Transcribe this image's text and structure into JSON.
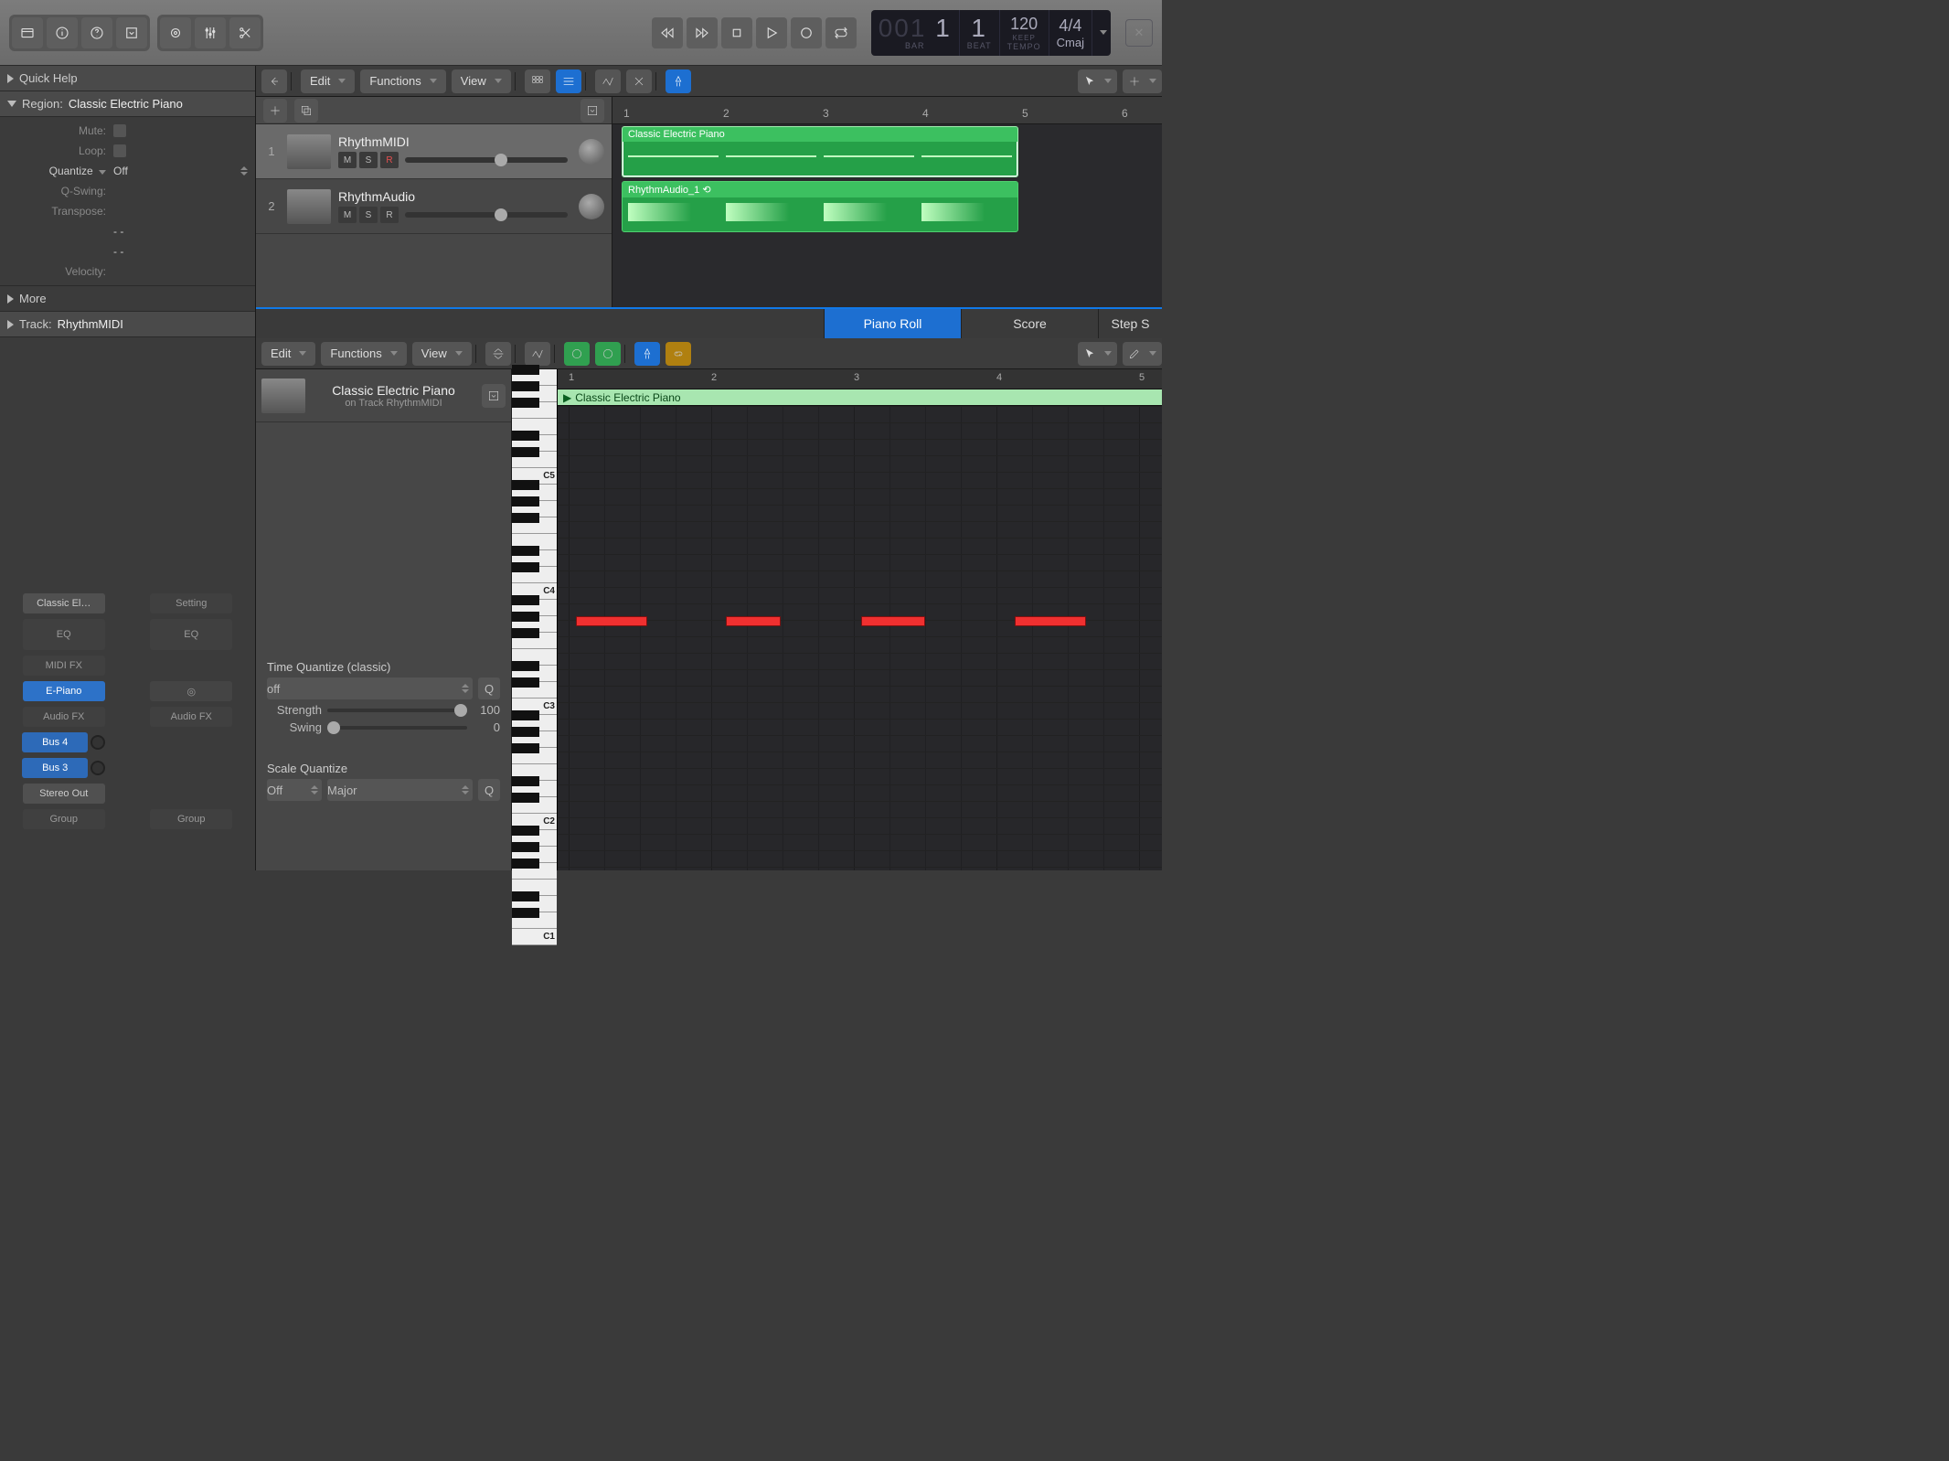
{
  "toolbar": {
    "lcd": {
      "bar": "1",
      "beat": "1",
      "bar_lbl": "BAR",
      "beat_lbl": "BEAT",
      "tempo": "120",
      "tempo_sub": "KEEP",
      "tempo_lbl": "TEMPO",
      "sig": "4/4",
      "key": "Cmaj",
      "bar_prefix": "001"
    }
  },
  "inspector": {
    "quick_help": "Quick Help",
    "region_lbl": "Region:",
    "region_name": "Classic Electric Piano",
    "mute": "Mute:",
    "loop": "Loop:",
    "quantize": "Quantize",
    "quantize_v": "Off",
    "qswing": "Q-Swing:",
    "transpose": "Transpose:",
    "dash1": "- -",
    "dash2": "- -",
    "velocity": "Velocity:",
    "more": "More",
    "track_lbl": "Track:",
    "track_name": "RhythmMIDI"
  },
  "strips": {
    "a": {
      "preset": "Classic El…",
      "eq": "EQ",
      "midifx": "MIDI FX",
      "inst": "E-Piano",
      "audiofx": "Audio FX",
      "send1": "Bus 4",
      "send2": "Bus 3",
      "out": "Stereo Out",
      "grp": "Group"
    },
    "b": {
      "setting": "Setting",
      "eq": "EQ",
      "audiofx": "Audio FX",
      "grp": "Group"
    }
  },
  "menus": {
    "edit": "Edit",
    "functions": "Functions",
    "view": "View"
  },
  "tracks": {
    "t1": {
      "num": "1",
      "name": "RhythmMIDI",
      "m": "M",
      "s": "S",
      "r": "R"
    },
    "t2": {
      "num": "2",
      "name": "RhythmAudio",
      "m": "M",
      "s": "S",
      "r": "R"
    },
    "clip1": "Classic Electric Piano",
    "clip2": "RhythmAudio_1",
    "ruler": {
      "r1": "1",
      "r2": "2",
      "r3": "3",
      "r4": "4",
      "r5": "5",
      "r6": "6"
    }
  },
  "editor": {
    "tabs": {
      "piano": "Piano Roll",
      "score": "Score",
      "step": "Step S"
    },
    "region": "Classic Electric Piano",
    "region_sub": "on Track RhythmMIDI",
    "tq": "Time Quantize (classic)",
    "tq_v": "off",
    "q": "Q",
    "strength": "Strength",
    "strength_v": "100",
    "swing": "Swing",
    "swing_v": "0",
    "sq": "Scale Quantize",
    "sq_v1": "Off",
    "sq_v2": "Major",
    "ruler": {
      "r1": "1",
      "r2": "2",
      "r3": "3",
      "r4": "4",
      "r5": "5"
    },
    "region_hdr": "Classic Electric Piano",
    "c3": "C3",
    "c2": "C2"
  }
}
